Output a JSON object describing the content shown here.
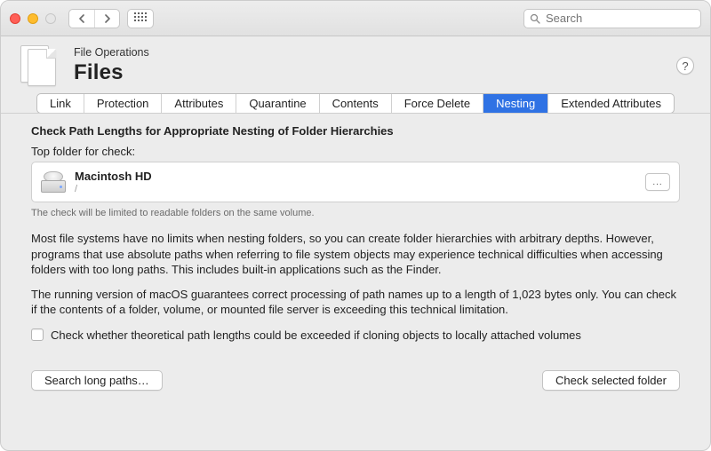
{
  "search": {
    "placeholder": "Search"
  },
  "header": {
    "subtitle": "File Operations",
    "title": "Files"
  },
  "tabs": [
    "Link",
    "Protection",
    "Attributes",
    "Quarantine",
    "Contents",
    "Force Delete",
    "Nesting",
    "Extended Attributes"
  ],
  "active_tab": "Nesting",
  "section_title": "Check Path Lengths for Appropriate Nesting of Folder Hierarchies",
  "field_label": "Top folder for check:",
  "folder": {
    "name": "Macintosh HD",
    "path": "/"
  },
  "browse_label": "...",
  "hint": "The check will be limited to readable folders on the same volume.",
  "para1": "Most file systems have no limits when nesting folders, so you can create folder hierarchies with arbitrary depths. However, programs that use absolute paths when referring to file system objects may experience technical difficulties when accessing folders with too long paths. This includes built-in applications such as the Finder.",
  "para2": "The running version of macOS guarantees correct processing of path names up to a length of 1,023 bytes only. You can check if the contents of a folder, volume, or mounted file server is exceeding this technical limitation.",
  "checkbox_label": "Check whether theoretical path lengths could be exceeded if cloning objects to locally attached volumes",
  "buttons": {
    "search_paths": "Search long paths…",
    "check_folder": "Check selected folder"
  },
  "help_label": "?"
}
